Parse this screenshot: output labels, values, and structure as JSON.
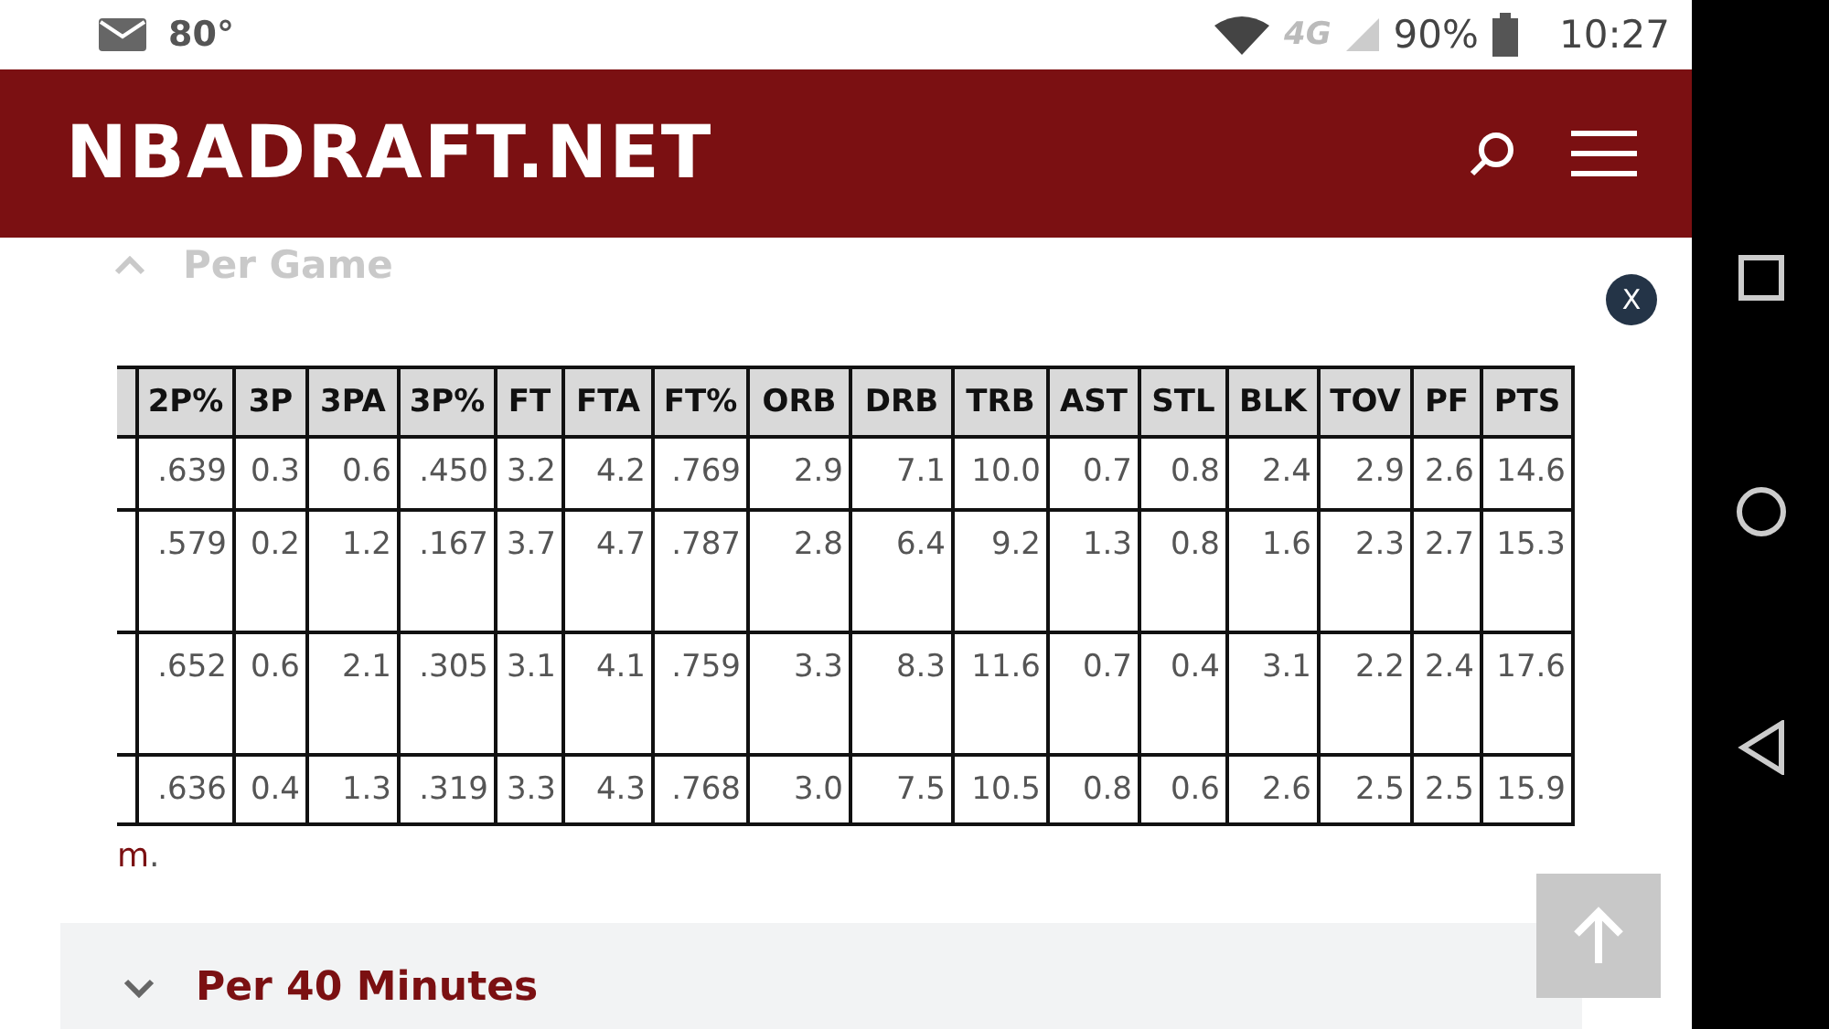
{
  "status_bar": {
    "temperature": "80°",
    "network": "4G",
    "battery": "90%",
    "time": "10:27"
  },
  "header": {
    "logo": "NBADRAFT.NET"
  },
  "sections": [
    {
      "title": "Per Game",
      "expanded": true
    },
    {
      "title": "Per 40 Minutes",
      "expanded": false
    }
  ],
  "table": {
    "columns": [
      "2P%",
      "3P",
      "3PA",
      "3P%",
      "FT",
      "FTA",
      "FT%",
      "ORB",
      "DRB",
      "TRB",
      "AST",
      "STL",
      "BLK",
      "TOV",
      "PF",
      "PTS"
    ],
    "rows": [
      [
        ".639",
        "0.3",
        "0.6",
        ".450",
        "3.2",
        "4.2",
        ".769",
        "2.9",
        "7.1",
        "10.0",
        "0.7",
        "0.8",
        "2.4",
        "2.9",
        "2.6",
        "14.6"
      ],
      [
        ".579",
        "0.2",
        "1.2",
        ".167",
        "3.7",
        "4.7",
        ".787",
        "2.8",
        "6.4",
        "9.2",
        "1.3",
        "0.8",
        "1.6",
        "2.3",
        "2.7",
        "15.3"
      ],
      [
        ".652",
        "0.6",
        "2.1",
        ".305",
        "3.1",
        "4.1",
        ".759",
        "3.3",
        "8.3",
        "11.6",
        "0.7",
        "0.4",
        "3.1",
        "2.2",
        "2.4",
        "17.6"
      ],
      [
        ".636",
        "0.4",
        "1.3",
        ".319",
        "3.3",
        "4.3",
        ".768",
        "3.0",
        "7.5",
        "10.5",
        "0.8",
        "0.6",
        "2.6",
        "2.5",
        "2.5",
        "15.9"
      ]
    ]
  },
  "source_link": "m",
  "source_suffix": ".",
  "close_button": "X"
}
